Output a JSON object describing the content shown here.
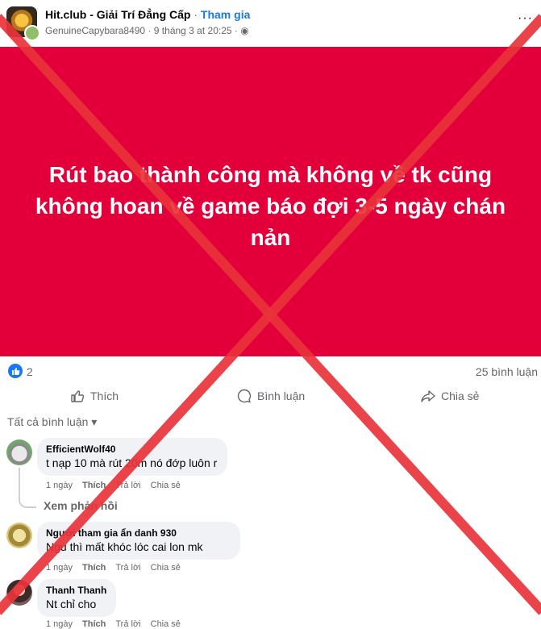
{
  "post": {
    "group_name": "Hit.club - Giải Trí Đẳng Cấp",
    "separator": "·",
    "join_label": "Tham gia",
    "author": "GenuineCapybara8490",
    "timestamp": "9 tháng 3 at 20:25",
    "globe": "◉",
    "more": "···",
    "banner_text": "Rút bao thành công mà không về tk cũng không hoan về game báo đợi 3-5 ngày chán nản"
  },
  "stats": {
    "like_count": "2",
    "comment_count": "25 bình luận"
  },
  "actions": {
    "like": "Thích",
    "comment": "Bình luận",
    "share": "Chia sẻ"
  },
  "filter": "Tất cả bình luận ▾",
  "comments": [
    {
      "name": "EfficientWolf40",
      "text": "t nạp 10 mà rút 20m nó đớp luôn r",
      "time": "1 ngày",
      "like": "Thích",
      "reply": "Trả lời",
      "share": "Chia sẻ"
    },
    {
      "name": "Người tham gia ẩn danh 930",
      "text": "Ngu thì mất khóc lóc cai lon mk",
      "time": "1 ngày",
      "like": "Thích",
      "reply": "Trả lời",
      "share": "Chia sẻ"
    },
    {
      "name": "Thanh Thanh",
      "text": "Nt chỉ cho",
      "time": "1 ngày",
      "like": "Thích",
      "reply": "Trả lời",
      "share": "Chia sẻ"
    }
  ],
  "view_replies": "Xem phản hồi",
  "colors": {
    "banner": "#e3003a",
    "x_overlay": "#e8333a",
    "accent": "#1877f2"
  }
}
